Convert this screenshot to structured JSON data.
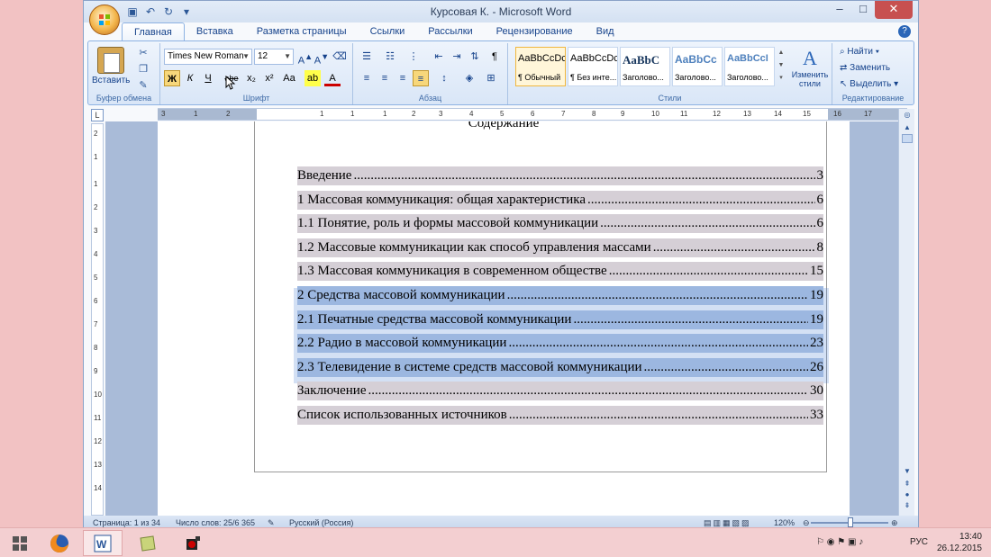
{
  "window": {
    "title": "Курсовая К. - Microsoft Word",
    "controls": {
      "minimize": "–",
      "maximize": "□",
      "close": "✕"
    }
  },
  "qat": {
    "save": "save-icon",
    "undo": "undo-icon",
    "redo": "redo-icon",
    "customize": "▾"
  },
  "tabs": [
    "Главная",
    "Вставка",
    "Разметка страницы",
    "Ссылки",
    "Рассылки",
    "Рецензирование",
    "Вид"
  ],
  "active_tab": "Главная",
  "ribbon": {
    "clipboard": {
      "paste_label": "Вставить",
      "group_label": "Буфер обмена"
    },
    "font": {
      "font_name": "Times New Roman",
      "font_size": "12",
      "group_label": "Шрифт",
      "buttons": [
        "Ж",
        "К",
        "Ч",
        "abe",
        "x₂",
        "x²",
        "Aa"
      ]
    },
    "paragraph": {
      "group_label": "Абзац",
      "pilcrow": "¶"
    },
    "styles": {
      "group_label": "Стили",
      "items": [
        {
          "preview": "AaBbCcDc",
          "name": "¶ Обычный"
        },
        {
          "preview": "AaBbCcDc",
          "name": "¶ Без инте..."
        },
        {
          "preview": "AaBbC",
          "name": "Заголово..."
        },
        {
          "preview": "AaBbCc",
          "name": "Заголово..."
        },
        {
          "preview": "AaBbCcI",
          "name": "Заголово..."
        }
      ],
      "change_styles": "Изменить стили"
    },
    "editing": {
      "group_label": "Редактирование",
      "find": "Найти",
      "replace": "Заменить",
      "select": "Выделить"
    }
  },
  "ruler": {
    "corner": "L",
    "numbers": [
      "3",
      "1",
      "2",
      "1",
      "1",
      "1",
      "2",
      "3",
      "4",
      "5",
      "6",
      "7",
      "8",
      "9",
      "10",
      "11",
      "12",
      "13",
      "14",
      "15",
      "16",
      "17"
    ],
    "vnumbers": [
      "2",
      "1",
      "1",
      "2",
      "3",
      "4",
      "5",
      "6",
      "7",
      "8",
      "9",
      "10",
      "11",
      "12",
      "13",
      "14"
    ]
  },
  "document": {
    "heading": "Содержание",
    "toc": [
      {
        "title": "Введение",
        "page": "3",
        "selected": false
      },
      {
        "title": "1 Массовая коммуникация: общая характеристика ",
        "page": "6",
        "selected": false
      },
      {
        "title": "1.1 Понятие, роль и формы массовой коммуникации",
        "page": "6",
        "selected": false
      },
      {
        "title": "1.2 Массовые коммуникации как способ управления массами",
        "page": "8",
        "selected": false
      },
      {
        "title": "1.3 Массовая коммуникация в современном обществе ",
        "page": "15",
        "selected": false
      },
      {
        "title": "2 Средства массовой коммуникации ",
        "page": "19",
        "selected": true
      },
      {
        "title": "2.1 Печатные средства массовой коммуникации",
        "page": "19",
        "selected": true
      },
      {
        "title": "2.2 Радио в массовой коммуникации",
        "page": "23",
        "selected": true
      },
      {
        "title": "2.3 Телевидение в системе средств массовой коммуникации ",
        "page": "26",
        "selected": true
      },
      {
        "title": "Заключение",
        "page": "30",
        "selected": false
      },
      {
        "title": "Список использованных источников",
        "page": "33",
        "selected": false
      }
    ]
  },
  "status": {
    "page": "Страница: 1 из 34",
    "words": "Число слов: 25/6 365",
    "language": "Русский (Россия)",
    "zoom": "120%"
  },
  "taskbar": {
    "apps": [
      "windows-start-icon",
      "firefox-icon",
      "word-icon",
      "notes-icon",
      "camera-icon"
    ],
    "tray_lang": "РУС",
    "time": "13:40",
    "date": "26.12.2015"
  },
  "colors": {
    "selection": "#9cb7e0",
    "field_shading": "#d5cfd6",
    "desktop": "#f2c2c3"
  }
}
